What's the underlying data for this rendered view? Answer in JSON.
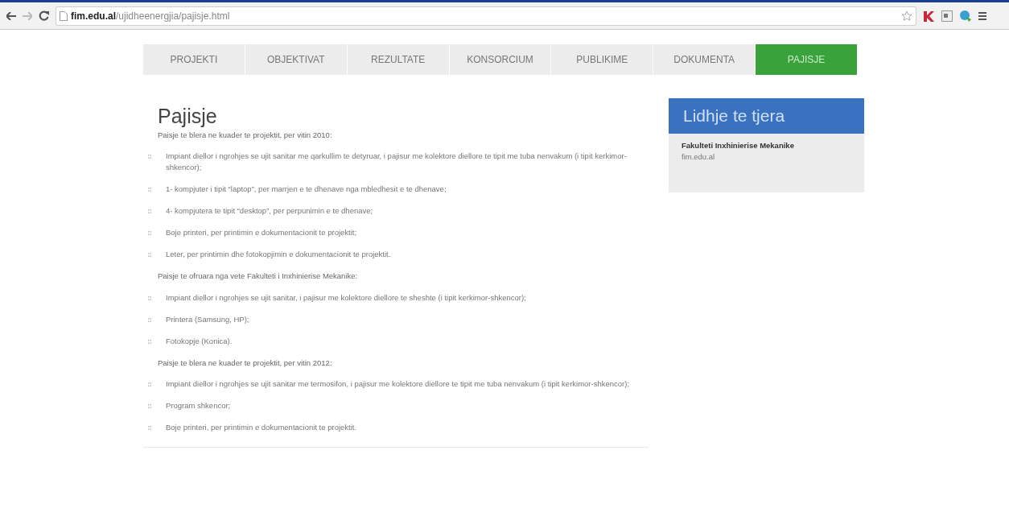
{
  "browser": {
    "url_domain": "fim.edu.al",
    "url_path": "/ujidheenergjia/pajisje.html"
  },
  "nav": [
    {
      "label": "PROJEKTI",
      "selected": false
    },
    {
      "label": "OBJEKTIVAT",
      "selected": false
    },
    {
      "label": "REZULTATE",
      "selected": false
    },
    {
      "label": "KONSORCIUM",
      "selected": false
    },
    {
      "label": "PUBLIKIME",
      "selected": false
    },
    {
      "label": "DOKUMENTA",
      "selected": false
    },
    {
      "label": "PAJISJE",
      "selected": true
    }
  ],
  "main": {
    "title": "Pajisje",
    "sections": [
      {
        "intro": "Paisje te blera ne kuader te projektit, per vitin 2010:",
        "items": [
          "Impiant diellor i ngrohjes se ujit sanitar me qarkullim te detyruar, i pajisur me kolektore diellore te tipit me tuba nenvakum (i tipit kerkimor-shkencor);",
          "1- kompjuter i tipit “laptop”, per marrjen e te dhenave nga mbledhesit e te dhenave;",
          "4- kompjutera te tipit “desktop”, per perpunimin e te dhenave;",
          "Boje printeri, per printimin e dokumentacionit te projektit;",
          "Leter, per printimin dhe fotokopjimin e dokumentacionit te projektit."
        ]
      },
      {
        "intro": "Paisje te ofruara nga vete Fakulteti i Inxhinierise Mekanike:",
        "items": [
          "Impiant diellor i ngrohjes se ujit sanitar, i pajisur me kolektore diellore te sheshte (i tipit kerkimor-shkencor);",
          "Printera (Samsung, HP);",
          "Fotokopje (Konica)."
        ]
      },
      {
        "intro": "Paisje te blera ne kuader te projektit, per vitin 2012:",
        "items": [
          "Impiant diellor i ngrohjes se ujit sanitar me termosifon, i pajisur me kolektore diellore te tipit me tuba nenvakum (i tipit kerkimor-shkencor);",
          "Program shkencor;",
          "Boje printeri, per printimin e dokumentacionit te projektit."
        ]
      }
    ]
  },
  "sidebar": {
    "title": "Lidhje te tjera",
    "links": [
      {
        "name": "Fakulteti Inxhinierise Mekanike",
        "url": "fim.edu.al"
      }
    ]
  }
}
